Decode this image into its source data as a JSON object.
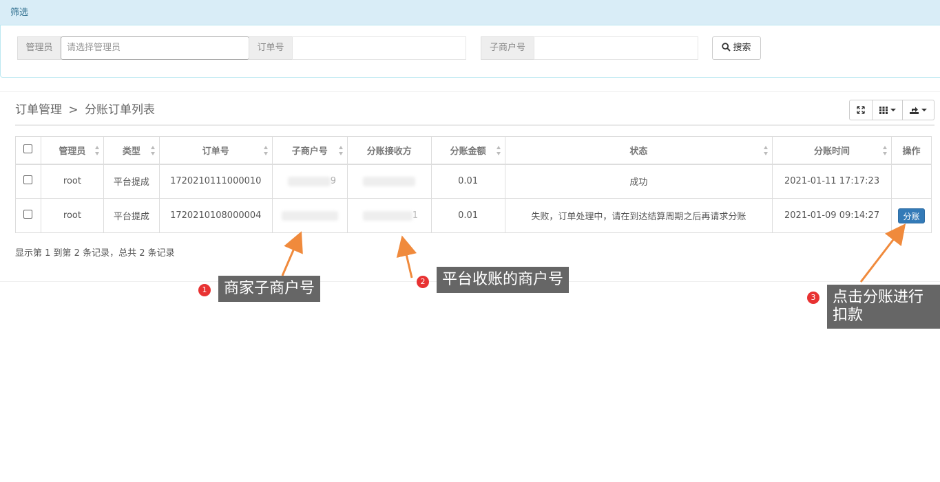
{
  "filter": {
    "header": "筛选",
    "admin_label": "管理员",
    "admin_placeholder": "请选择管理员",
    "order_label": "订单号",
    "order_value": "",
    "sub_merchant_label": "子商户号",
    "sub_merchant_value": "",
    "search_label": "搜索"
  },
  "breadcrumb": {
    "root": "订单管理",
    "separator": ">",
    "current": "分账订单列表"
  },
  "toolbar": {
    "icons": [
      "fullscreen-icon",
      "columns-icon",
      "export-icon"
    ]
  },
  "table": {
    "columns": [
      "管理员",
      "类型",
      "订单号",
      "子商户号",
      "分账接收方",
      "分账金额",
      "状态",
      "分账时间",
      "操作"
    ],
    "rows": [
      {
        "admin": "root",
        "type": "平台提成",
        "order_no": "1720210111000010",
        "sub_merchant": "9",
        "receiver": "",
        "amount": "0.01",
        "status": "成功",
        "time": "2021-01-11 17:17:23",
        "action": ""
      },
      {
        "admin": "root",
        "type": "平台提成",
        "order_no": "1720210108000004",
        "sub_merchant": "",
        "receiver": "1",
        "amount": "0.01",
        "status": "失败，订单处理中，请在到达结算周期之后再请求分账",
        "time": "2021-01-09 09:14:27",
        "action": "分账"
      }
    ]
  },
  "pagination": {
    "summary": "显示第 1 到第 2 条记录，总共 2 条记录"
  },
  "annotations": [
    {
      "num": "1",
      "text": "商家子商户号"
    },
    {
      "num": "2",
      "text": "平台收账的商户号"
    },
    {
      "num": "3",
      "text": "点击分账进行扣款"
    }
  ],
  "colors": {
    "filter_header_bg": "#d9edf7",
    "primary_button": "#337ab7",
    "callout_bg": "#666666",
    "arrow": "#f08a3c",
    "badge": "#e83232"
  }
}
